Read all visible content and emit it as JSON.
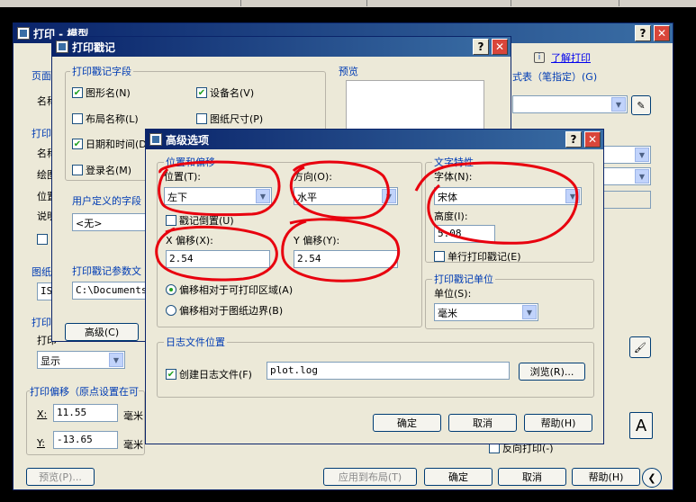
{
  "back": {
    "title": "打印 - 模型",
    "help_link": "了解打印",
    "style_label": "式表（笔指定）(G)",
    "page_label": "页面",
    "name_label": "名称",
    "print_label": "打印",
    "name2": "名称",
    "plotter": "绘图",
    "position": "位置",
    "desc": "说明",
    "paper": "图纸",
    "paper_val": "ISO",
    "print_area_label": "打印",
    "print_area_sub": "打印",
    "show": "显示",
    "offset_title": "打印偏移（原点设置在可",
    "x_label": "X:",
    "x_val": "11.55",
    "y_label": "Y:",
    "y_val": "-13.65",
    "unit_mm": "毫米",
    "preview_btn": "预览(P)...",
    "apply_btn": "应用到布局(T)",
    "ok": "确定",
    "cancel": "取消",
    "help": "帮助(H)",
    "reverse_print": "反向打印(-)",
    "stamp_indicator": "A"
  },
  "stamp": {
    "title": "打印戳记",
    "fields_group": "打印戳记字段",
    "preview_group": "预览",
    "drawing_name": "图形名(N)",
    "device_name": "设备名(V)",
    "layout_name": "布局名称(L)",
    "paper_size": "图纸尺寸(P)",
    "datetime": "日期和时间(D)",
    "login_name": "登录名(M)",
    "user_fields": "用户定义的字段",
    "none": "<无>",
    "param_file": "打印戳记参数文",
    "param_path": "C:\\Documents",
    "advanced_btn": "高级(C)"
  },
  "adv": {
    "title": "高级选项",
    "pos_group": "位置和偏移",
    "location_label": "位置(T):",
    "location_val": "左下",
    "orient_label": "方向(O):",
    "orient_val": "水平",
    "upside_down": "戳记倒置(U)",
    "x_offset_label": "X 偏移(X):",
    "x_offset_val": "2.54",
    "y_offset_label": "Y 偏移(Y):",
    "y_offset_val": "2.54",
    "rel_printable": "偏移相对于可打印区域(A)",
    "rel_border": "偏移相对于图纸边界(B)",
    "text_group": "文字特性",
    "font_label": "字体(N):",
    "font_val": "宋体",
    "height_label": "高度(I):",
    "height_val": "5.08",
    "single_line": "单行打印戳记(E)",
    "units_group": "打印戳记单位",
    "units_label": "单位(S):",
    "units_val": "毫米",
    "log_group": "日志文件位置",
    "create_log": "创建日志文件(F)",
    "log_file": "plot.log",
    "browse": "浏览(R)...",
    "ok": "确定",
    "cancel": "取消",
    "help": "帮助(H)"
  }
}
